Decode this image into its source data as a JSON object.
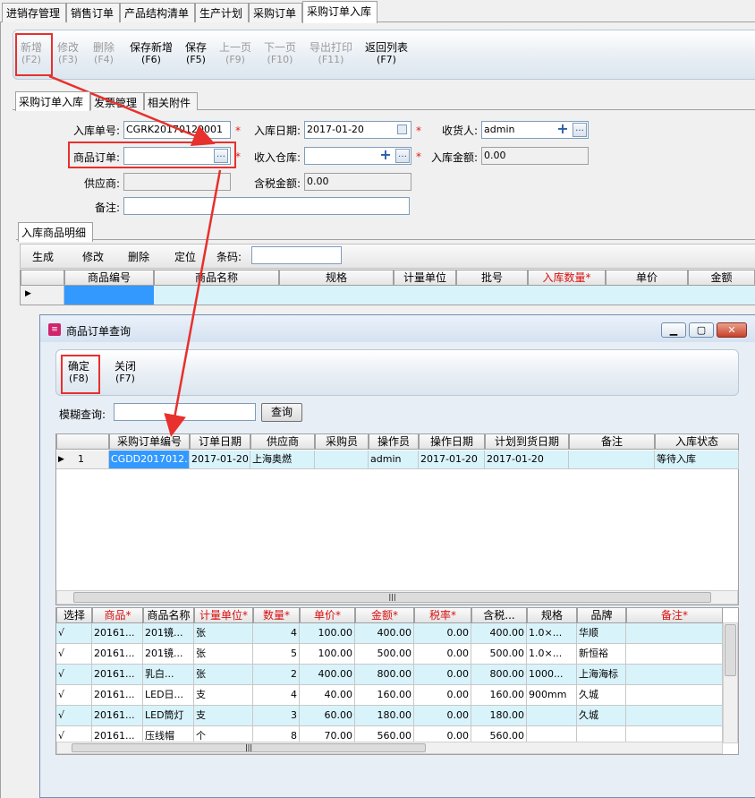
{
  "top_tabs": [
    "进销存管理",
    "销售订单",
    "产品结构清单",
    "生产计划",
    "采购订单",
    "采购订单入库"
  ],
  "toolbar": [
    {
      "label": "新增",
      "key": "(F2)",
      "enabled": false
    },
    {
      "label": "修改",
      "key": "(F3)",
      "enabled": false
    },
    {
      "label": "删除",
      "key": "(F4)",
      "enabled": false
    },
    {
      "label": "保存新增",
      "key": "(F6)",
      "enabled": true
    },
    {
      "label": "保存",
      "key": "(F5)",
      "enabled": true
    },
    {
      "label": "上一页",
      "key": "(F9)",
      "enabled": false
    },
    {
      "label": "下一页",
      "key": "(F10)",
      "enabled": false
    },
    {
      "label": "导出打印",
      "key": "(F11)",
      "enabled": false
    },
    {
      "label": "返回列表",
      "key": "(F7)",
      "enabled": true
    }
  ],
  "sub_tabs": [
    "采购订单入库",
    "发票管理",
    "相关附件"
  ],
  "form": {
    "receipt_no_label": "入库单号:",
    "receipt_no": "CGRK20170120001",
    "date_label": "入库日期:",
    "date": "2017-01-20",
    "receiver_label": "收货人:",
    "receiver": "admin",
    "order_label": "商品订单:",
    "order": "",
    "warehouse_label": "收入仓库:",
    "warehouse": "",
    "amount_label": "入库金额:",
    "amount": "0.00",
    "supplier_label": "供应商:",
    "supplier": "",
    "tax_amount_label": "含税金额:",
    "tax_amount": "0.00",
    "note_label": "备注:",
    "note": ""
  },
  "detail": {
    "tab": "入库商品明细",
    "buttons": [
      "生成",
      "修改",
      "删除",
      "定位"
    ],
    "barcode_label": "条码:",
    "columns": [
      "商品编号",
      "商品名称",
      "规格",
      "计量单位",
      "批号",
      "入库数量*",
      "单价",
      "金额"
    ]
  },
  "dialog": {
    "title": "商品订单查询",
    "buttons": [
      {
        "label": "确定",
        "key": "(F8)"
      },
      {
        "label": "关闭",
        "key": "(F7)"
      }
    ],
    "search_label": "模糊查询:",
    "search_button": "查询",
    "order_columns": [
      "采购订单编号",
      "订单日期",
      "供应商",
      "采购员",
      "操作员",
      "操作日期",
      "计划到货日期",
      "备注",
      "入库状态"
    ],
    "order_rows": [
      [
        "1",
        "CGDD2017012...",
        "2017-01-20",
        "上海奥燃",
        "",
        "admin",
        "2017-01-20",
        "2017-01-20",
        "",
        "等待入库"
      ]
    ],
    "item_columns": [
      "选择",
      "商品*",
      "商品名称",
      "计量单位*",
      "数量*",
      "单价*",
      "金额*",
      "税率*",
      "含税...",
      "规格",
      "品牌",
      "备注*"
    ],
    "item_rows": [
      [
        "√",
        "20161...",
        "201镜...",
        "张",
        "4",
        "100.00",
        "400.00",
        "0.00",
        "400.00",
        "1.0×...",
        "华顺",
        ""
      ],
      [
        "√",
        "20161...",
        "201镜...",
        "张",
        "5",
        "100.00",
        "500.00",
        "0.00",
        "500.00",
        "1.0×...",
        "新恒裕",
        ""
      ],
      [
        "√",
        "20161...",
        "乳白...",
        "张",
        "2",
        "400.00",
        "800.00",
        "0.00",
        "800.00",
        "1000...",
        "上海海标",
        ""
      ],
      [
        "√",
        "20161...",
        "LED日...",
        "支",
        "4",
        "40.00",
        "160.00",
        "0.00",
        "160.00",
        "900mm",
        "久城",
        ""
      ],
      [
        "√",
        "20161...",
        "LED筒灯",
        "支",
        "3",
        "60.00",
        "180.00",
        "0.00",
        "180.00",
        "",
        "久城",
        ""
      ],
      [
        "√",
        "20161...",
        "压线帽",
        "个",
        "8",
        "70.00",
        "560.00",
        "0.00",
        "560.00",
        "",
        "",
        ""
      ]
    ]
  },
  "colors": {
    "highlight": "#e8302c",
    "row_alt": "#d9f3fb",
    "selected": "#3399ff"
  }
}
